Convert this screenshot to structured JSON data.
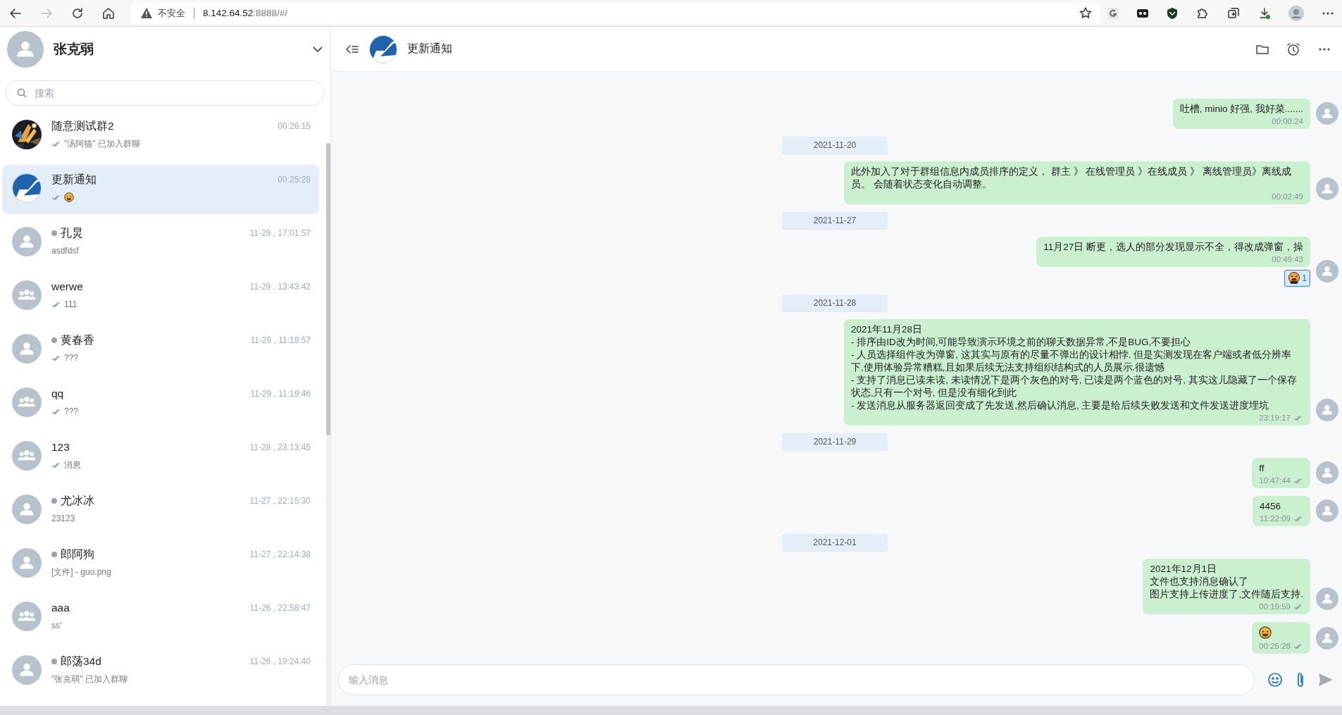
{
  "browser": {
    "security_label": "不安全",
    "url_host": "8.142.64.52",
    "url_rest": ":8888/#/"
  },
  "user": {
    "name": "张克弱"
  },
  "search": {
    "placeholder": "搜索"
  },
  "conversations": [
    {
      "kind": "picture",
      "name": "随意测试群2",
      "time": "00:26:15",
      "preview": {
        "kind": "text",
        "text": "\"汤阿猫\" 已加入群聊"
      },
      "ticks": true,
      "selected": false
    },
    {
      "kind": "logo",
      "name": "更新通知",
      "time": "00:25:28",
      "preview": {
        "kind": "emoji"
      },
      "ticks": true,
      "selected": true
    },
    {
      "kind": "person",
      "online": false,
      "name": "孔炅",
      "time": "11-29 , 17:01:57",
      "preview": {
        "kind": "text",
        "text": "asdfdsf"
      },
      "ticks": false,
      "selected": false
    },
    {
      "kind": "group",
      "name": "werwe",
      "time": "11-29 , 13:43:42",
      "preview": {
        "kind": "text",
        "text": "111"
      },
      "ticks": true,
      "selected": false
    },
    {
      "kind": "person",
      "online": false,
      "name": "黄春香",
      "time": "11-29 , 11:19:57",
      "preview": {
        "kind": "text",
        "text": "???"
      },
      "ticks": true,
      "selected": false
    },
    {
      "kind": "group",
      "name": "qq",
      "time": "11-29 , 11:19:46",
      "preview": {
        "kind": "text",
        "text": "???"
      },
      "ticks": true,
      "selected": false
    },
    {
      "kind": "group",
      "name": "123",
      "time": "11-28 , 23:13:45",
      "preview": {
        "kind": "text",
        "text": "消息"
      },
      "ticks": true,
      "selected": false
    },
    {
      "kind": "person",
      "online": false,
      "name": "尤冰冰",
      "time": "11-27 , 22:15:30",
      "preview": {
        "kind": "text",
        "text": "23123"
      },
      "ticks": false,
      "selected": false
    },
    {
      "kind": "person",
      "online": false,
      "name": "郎阿狗",
      "time": "11-27 , 22:14:38",
      "preview": {
        "kind": "text",
        "text": "[文件] - guo.png"
      },
      "ticks": false,
      "selected": false
    },
    {
      "kind": "group",
      "name": "aaa",
      "time": "11-26 , 22:58:47",
      "preview": {
        "kind": "text",
        "text": "ss'"
      },
      "ticks": false,
      "selected": false
    },
    {
      "kind": "person",
      "online": false,
      "name": "郎荡34d",
      "time": "11-26 , 19:24:40",
      "preview": {
        "kind": "text",
        "text": "\"张克弱\" 已加入群聊"
      },
      "ticks": false,
      "selected": false
    }
  ],
  "chat": {
    "title": "更新通知"
  },
  "messages": [
    {
      "kind": "text",
      "lines": [
        "吐槽, minio 好强, 我好菜......."
      ],
      "time": "00:00:24",
      "ticks": false
    },
    {
      "kind": "date",
      "text": "2021-11-20"
    },
    {
      "kind": "text",
      "lines": [
        "此外加入了对于群组信息内成员排序的定义， 群主 》 在线管理员 》在线成员 》 离线管理员》离线成员。 会随着状态变化自动调整。"
      ],
      "time": "00:02:49",
      "ticks": false
    },
    {
      "kind": "date",
      "text": "2021-11-27"
    },
    {
      "kind": "text",
      "lines": [
        "11月27日 断更，选人的部分发现显示不全，得改成弹窗，操"
      ],
      "time": "00:49:43",
      "ticks": false,
      "reaction": {
        "count": "1"
      }
    },
    {
      "kind": "date",
      "text": "2021-11-28"
    },
    {
      "kind": "text",
      "lines": [
        "2021年11月28日",
        "- 排序由ID改为时间,可能导致演示环境之前的聊天数据异常,不是BUG,不要担心",
        "- 人员选择组件改为弹窗, 这其实与原有的尽量不弹出的设计相悖. 但是实测发现在客户端或者低分辨率下,使用体验异常糟糕,且如果后续无法支持组织结构式的人员展示.很遗憾",
        "- 支持了消息已读未读, 未读情况下是两个灰色的对号, 已读是两个蓝色的对号, 其实这儿隐藏了一个保存状态,只有一个对号, 但是没有细化到此",
        "- 发送消息从服务器返回变成了先发送,然后确认消息, 主要是给后续失败发送和文件发送进度埋坑"
      ],
      "time": "23:19:17",
      "ticks": true
    },
    {
      "kind": "date",
      "text": "2021-11-29"
    },
    {
      "kind": "text",
      "lines": [
        "ff"
      ],
      "time": "10:47:44",
      "ticks": true
    },
    {
      "kind": "text",
      "lines": [
        "4456"
      ],
      "time": "11:22:09",
      "ticks": true
    },
    {
      "kind": "date",
      "text": "2021-12-01"
    },
    {
      "kind": "text",
      "lines": [
        "2021年12月1日",
        "文件也支持消息确认了",
        "图片支持上传进度了,文件随后支持."
      ],
      "time": "00:19:59",
      "ticks": true
    },
    {
      "kind": "emoji",
      "time": "00:25:28",
      "ticks": true
    }
  ],
  "composer": {
    "placeholder": "输入消息"
  }
}
